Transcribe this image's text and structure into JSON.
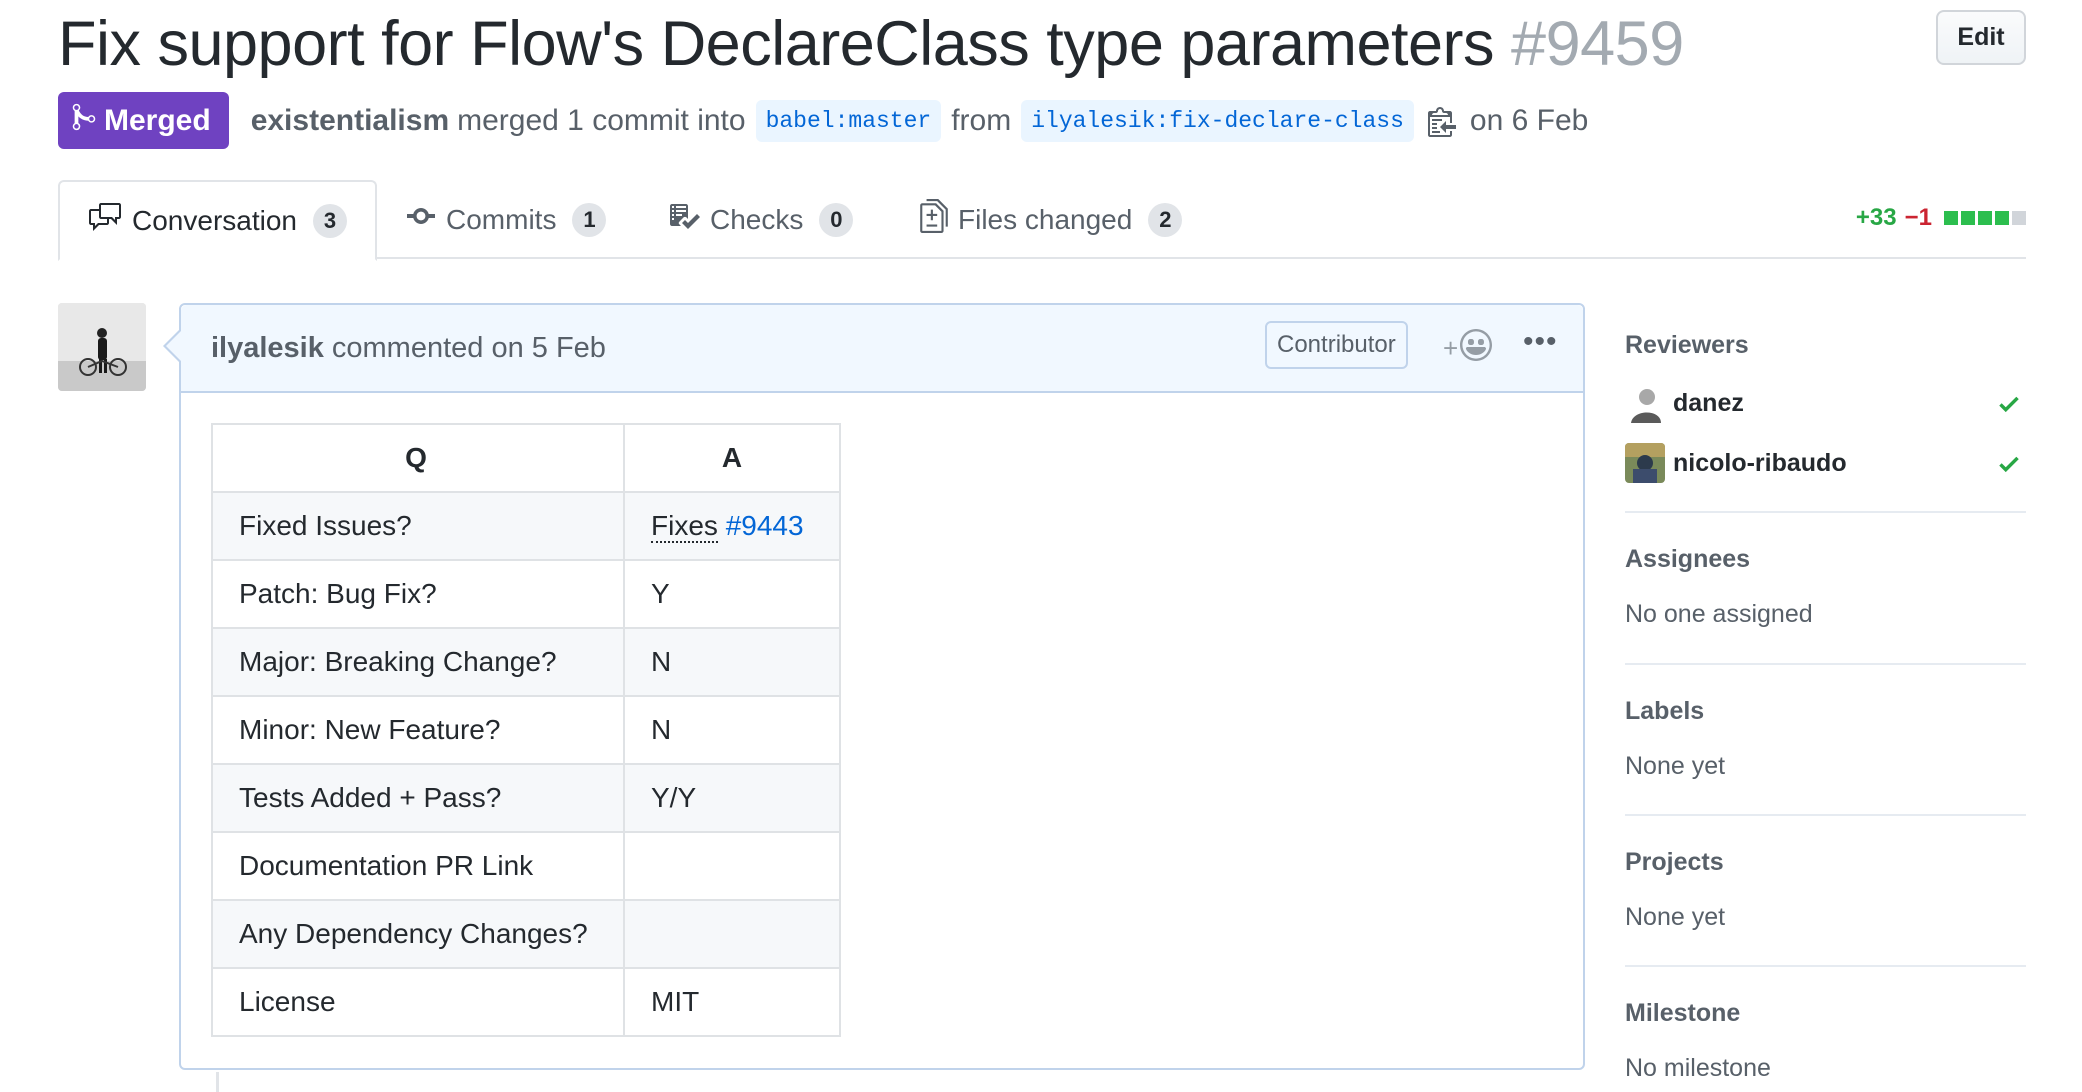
{
  "pr": {
    "title": "Fix support for Flow's DeclareClass type parameters",
    "number": "#9459",
    "edit_label": "Edit",
    "state_label": "Merged",
    "merged_by": "existentialism",
    "merge_text": "merged 1 commit into",
    "base_branch": "babel:master",
    "from_text": "from",
    "head_branch": "ilyalesik:fix-declare-class",
    "date_text": "on 6 Feb"
  },
  "tabs": [
    {
      "label": "Conversation",
      "count": "3",
      "icon": "comment-discussion-icon"
    },
    {
      "label": "Commits",
      "count": "1",
      "icon": "git-commit-icon"
    },
    {
      "label": "Checks",
      "count": "0",
      "icon": "checklist-icon"
    },
    {
      "label": "Files changed",
      "count": "2",
      "icon": "file-diff-icon"
    }
  ],
  "diffstat": {
    "additions": "+33",
    "deletions": "−1",
    "bars": [
      "green",
      "green",
      "green",
      "green",
      "grey"
    ],
    "colors": {
      "green": "#2cbe4e",
      "grey": "#d1d5da",
      "add_text": "#28a745",
      "del_text": "#cb2431"
    }
  },
  "comment": {
    "author": "ilyalesik",
    "action": "commented on 5 Feb",
    "role": "Contributor",
    "reaction_plus": "+",
    "more": "•••",
    "table": {
      "headers": [
        "Q",
        "A"
      ],
      "rows": [
        {
          "q": "Fixed Issues?",
          "a": "Fixes",
          "a_link": "#9443"
        },
        {
          "q": "Patch: Bug Fix?",
          "a": "Y"
        },
        {
          "q": "Major: Breaking Change?",
          "a": "N"
        },
        {
          "q": "Minor: New Feature?",
          "a": "N"
        },
        {
          "q": "Tests Added + Pass?",
          "a": "Y/Y"
        },
        {
          "q": "Documentation PR Link",
          "a": ""
        },
        {
          "q": "Any Dependency Changes?",
          "a": ""
        },
        {
          "q": "License",
          "a": "MIT"
        }
      ]
    }
  },
  "sidebar": {
    "reviewers": {
      "heading": "Reviewers",
      "items": [
        {
          "name": "danez",
          "status": "approved"
        },
        {
          "name": "nicolo-ribaudo",
          "status": "approved"
        }
      ]
    },
    "assignees": {
      "heading": "Assignees",
      "value": "No one assigned"
    },
    "labels": {
      "heading": "Labels",
      "value": "None yet"
    },
    "projects": {
      "heading": "Projects",
      "value": "None yet"
    },
    "milestone": {
      "heading": "Milestone",
      "value": "No milestone"
    }
  },
  "colors": {
    "merged_purple": "#6f42c1",
    "link_blue": "#0366d6",
    "approved_green": "#28a745",
    "comment_header_bg": "#f1f8ff"
  }
}
